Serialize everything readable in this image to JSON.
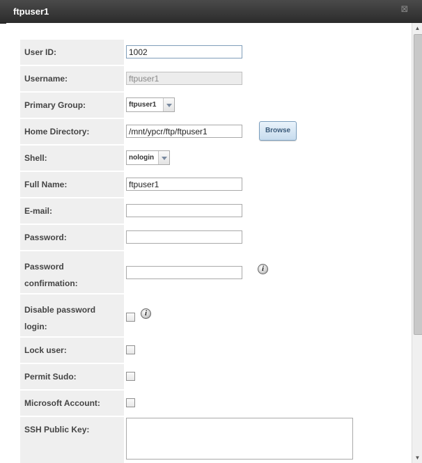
{
  "window": {
    "title": "ftpuser1",
    "close_glyph": "⊠"
  },
  "form": {
    "user_id": {
      "label": "User ID:",
      "value": "1002"
    },
    "username": {
      "label": "Username:",
      "value": "ftpuser1"
    },
    "primary_group": {
      "label": "Primary Group:",
      "value": "ftpuser1"
    },
    "home_directory": {
      "label": "Home Directory:",
      "value": "/mnt/ypcr/ftp/ftpuser1",
      "browse_label": "Browse"
    },
    "shell": {
      "label": "Shell:",
      "value": "nologin"
    },
    "full_name": {
      "label": "Full Name:",
      "value": "ftpuser1"
    },
    "email": {
      "label": "E-mail:",
      "value": ""
    },
    "password": {
      "label": "Password:",
      "value": ""
    },
    "password_confirmation": {
      "label_line1": "Password",
      "label_line2": "confirmation:",
      "value": ""
    },
    "disable_password_login": {
      "label_line1": "Disable password",
      "label_line2": "login:",
      "checked": false
    },
    "lock_user": {
      "label": "Lock user:",
      "checked": false
    },
    "permit_sudo": {
      "label": "Permit Sudo:",
      "checked": false
    },
    "microsoft_account": {
      "label": "Microsoft Account:",
      "checked": false
    },
    "ssh_public_key": {
      "label": "SSH Public Key:",
      "value": ""
    }
  },
  "icons": {
    "info": "i"
  }
}
